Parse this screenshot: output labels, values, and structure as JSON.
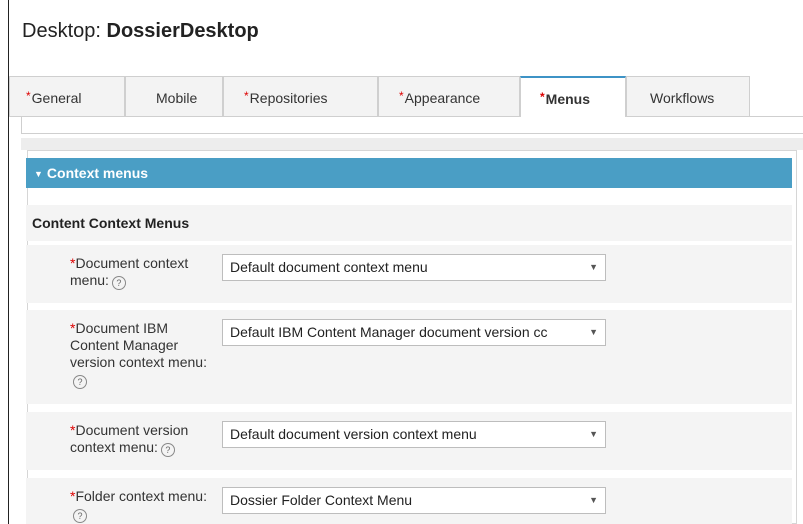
{
  "header": {
    "title_prefix": "Desktop:",
    "title_name": "DossierDesktop"
  },
  "tabs": [
    {
      "label": "General",
      "required": true,
      "active": false
    },
    {
      "label": "Mobile",
      "required": false,
      "active": false
    },
    {
      "label": "Repositories",
      "required": true,
      "active": false
    },
    {
      "label": "Appearance",
      "required": true,
      "active": false
    },
    {
      "label": "Menus",
      "required": true,
      "active": true
    },
    {
      "label": "Workflows",
      "required": false,
      "active": false
    }
  ],
  "panel": {
    "title": "Context menus",
    "section_title": "Content Context Menus",
    "fields": [
      {
        "label": "Document context menu:",
        "value": "Default document context menu"
      },
      {
        "label": "Document IBM Content Manager version context menu:",
        "value": "Default IBM Content Manager document version cc"
      },
      {
        "label": "Document version context menu:",
        "value": "Default document version context menu"
      },
      {
        "label": "Folder context menu:",
        "value": "Dossier Folder Context Menu"
      }
    ]
  },
  "glyphs": {
    "required_mark": "*",
    "help_icon": "?",
    "chevron_down": "▼",
    "collapse_chevron": "▼"
  },
  "colors": {
    "accent": "#4a9ec5",
    "tab_active_border": "#3d93c6",
    "required": "#dd0000"
  }
}
